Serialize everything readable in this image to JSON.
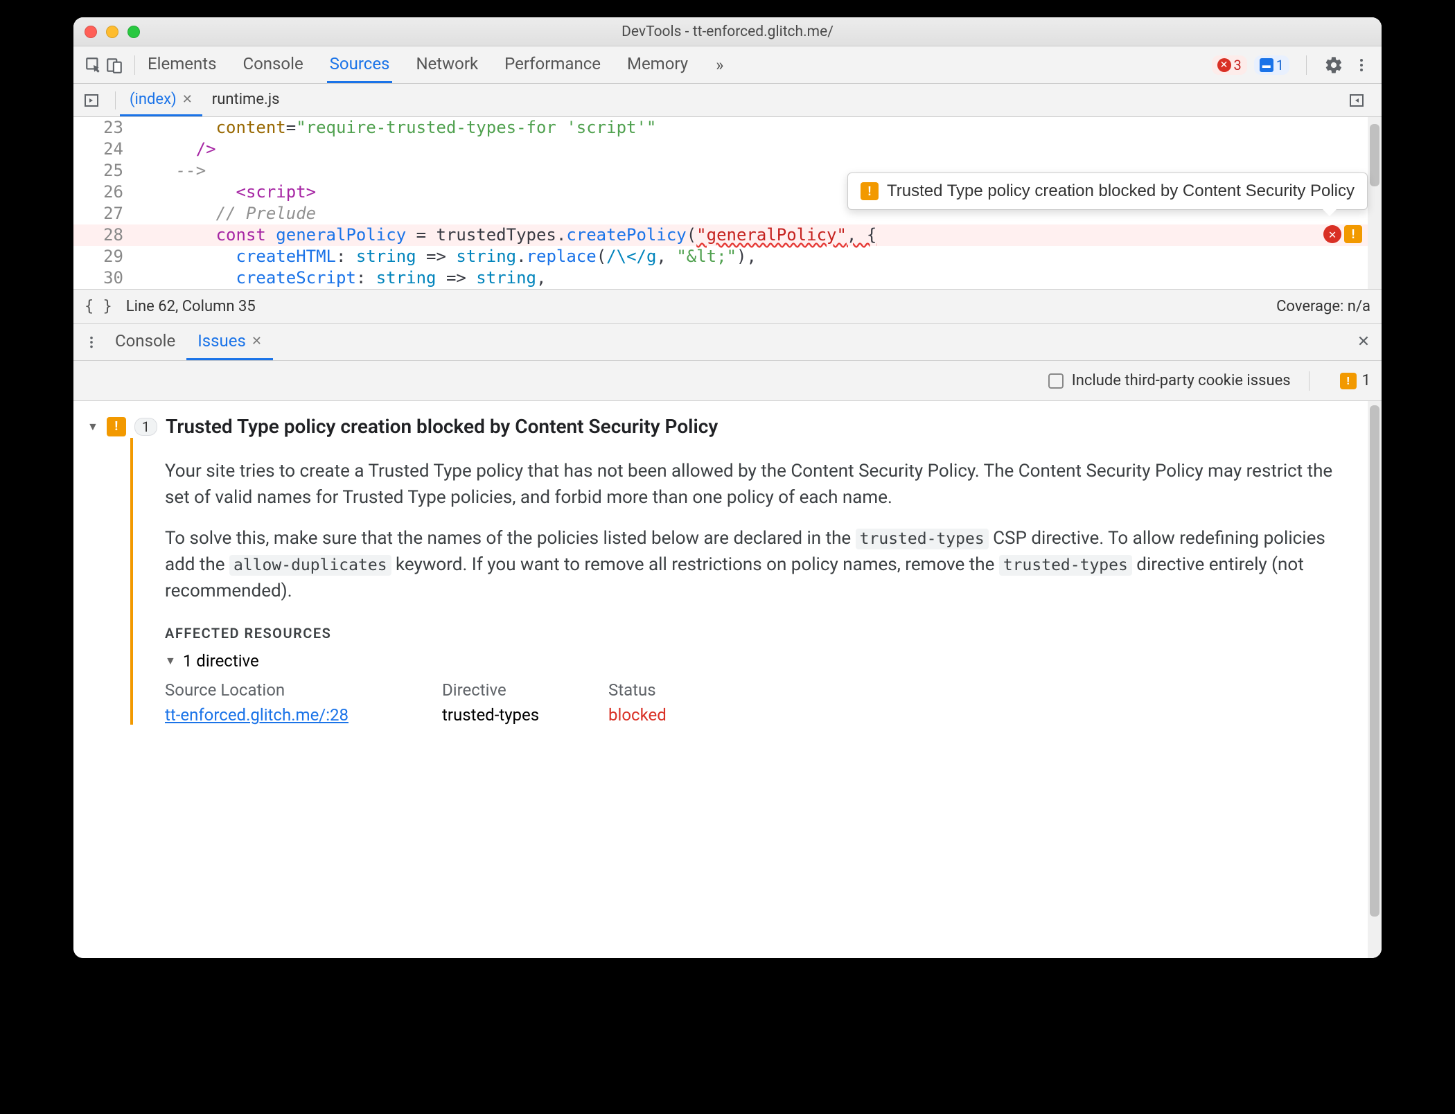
{
  "window": {
    "title": "DevTools - tt-enforced.glitch.me/"
  },
  "toolbar": {
    "tabs": [
      "Elements",
      "Console",
      "Sources",
      "Network",
      "Performance",
      "Memory"
    ],
    "active_tab": "Sources",
    "overflow_glyph": "»",
    "error_count": "3",
    "message_count": "1"
  },
  "file_tabs": {
    "tabs": [
      "(index)",
      "runtime.js"
    ],
    "active": "(index)"
  },
  "editor": {
    "line_start": 23,
    "lines": [
      {
        "n": 23,
        "indent": "        ",
        "tokens": [
          [
            "attr",
            "content"
          ],
          [
            "op",
            "="
          ],
          [
            "string",
            "\"require-trusted-types-for 'script'\""
          ]
        ]
      },
      {
        "n": 24,
        "indent": "      ",
        "tokens": [
          [
            "tag",
            "/>"
          ]
        ]
      },
      {
        "n": 25,
        "indent": "    ",
        "tokens": [
          [
            "comment",
            "-->"
          ]
        ]
      },
      {
        "n": 26,
        "indent": "          ",
        "tokens": [
          [
            "tag",
            "<script>"
          ]
        ]
      },
      {
        "n": 27,
        "indent": "        ",
        "tokens": [
          [
            "comment",
            "// Prelude"
          ]
        ]
      },
      {
        "n": 28,
        "indent": "        ",
        "hl": true,
        "tokens": [
          [
            "keyword",
            "const "
          ],
          [
            "function",
            "generalPolicy"
          ],
          [
            "op",
            " = trustedTypes."
          ],
          [
            "function",
            "createPolicy"
          ],
          [
            "op",
            "("
          ],
          [
            "string-red-squiggly",
            "\"generalPolicy\""
          ],
          [
            "op-squiggly",
            ", {"
          ]
        ]
      },
      {
        "n": 29,
        "indent": "          ",
        "tokens": [
          [
            "function",
            "createHTML"
          ],
          [
            "op",
            ": "
          ],
          [
            "type",
            "string"
          ],
          [
            "op",
            " => "
          ],
          [
            "type",
            "string"
          ],
          [
            "op",
            "."
          ],
          [
            "function",
            "replace"
          ],
          [
            "op",
            "("
          ],
          [
            "regex",
            "/\\</g"
          ],
          [
            "op",
            ", "
          ],
          [
            "string",
            "\"&lt;\""
          ],
          [
            "op",
            "),"
          ]
        ]
      },
      {
        "n": 30,
        "indent": "          ",
        "tokens": [
          [
            "function",
            "createScript"
          ],
          [
            "op",
            ": "
          ],
          [
            "type",
            "string"
          ],
          [
            "op",
            " => "
          ],
          [
            "type",
            "string"
          ],
          [
            "op",
            ","
          ]
        ]
      }
    ],
    "tooltip": "Trusted Type policy creation blocked by Content Security Policy"
  },
  "statusbar": {
    "position": "Line 62, Column 35",
    "coverage": "Coverage: n/a"
  },
  "drawer": {
    "tabs": [
      "Console",
      "Issues"
    ],
    "active": "Issues",
    "include_tp_label": "Include third-party cookie issues",
    "issue_count": "1"
  },
  "issue": {
    "count_pill": "1",
    "title": "Trusted Type policy creation blocked by Content Security Policy",
    "para1_a": "Your site tries to create a Trusted Type policy that has not been allowed by the Content Security Policy. The Content Security Policy may restrict the set of valid names for Trusted Type policies, and forbid more than one policy of each name.",
    "para2_a": "To solve this, make sure that the names of the policies listed below are declared in the ",
    "code1": "trusted-types",
    "para2_b": " CSP directive. To allow redefining policies add the ",
    "code2": "allow-duplicates",
    "para2_c": " keyword. If you want to remove all restrictions on policy names, remove the ",
    "code3": "trusted-types",
    "para2_d": " directive entirely (not recommended).",
    "affected_heading": "AFFECTED RESOURCES",
    "directive_count": "1 directive",
    "table": {
      "headers": [
        "Source Location",
        "Directive",
        "Status"
      ],
      "row": {
        "source": "tt-enforced.glitch.me/:28",
        "directive": "trusted-types",
        "status": "blocked"
      }
    }
  }
}
